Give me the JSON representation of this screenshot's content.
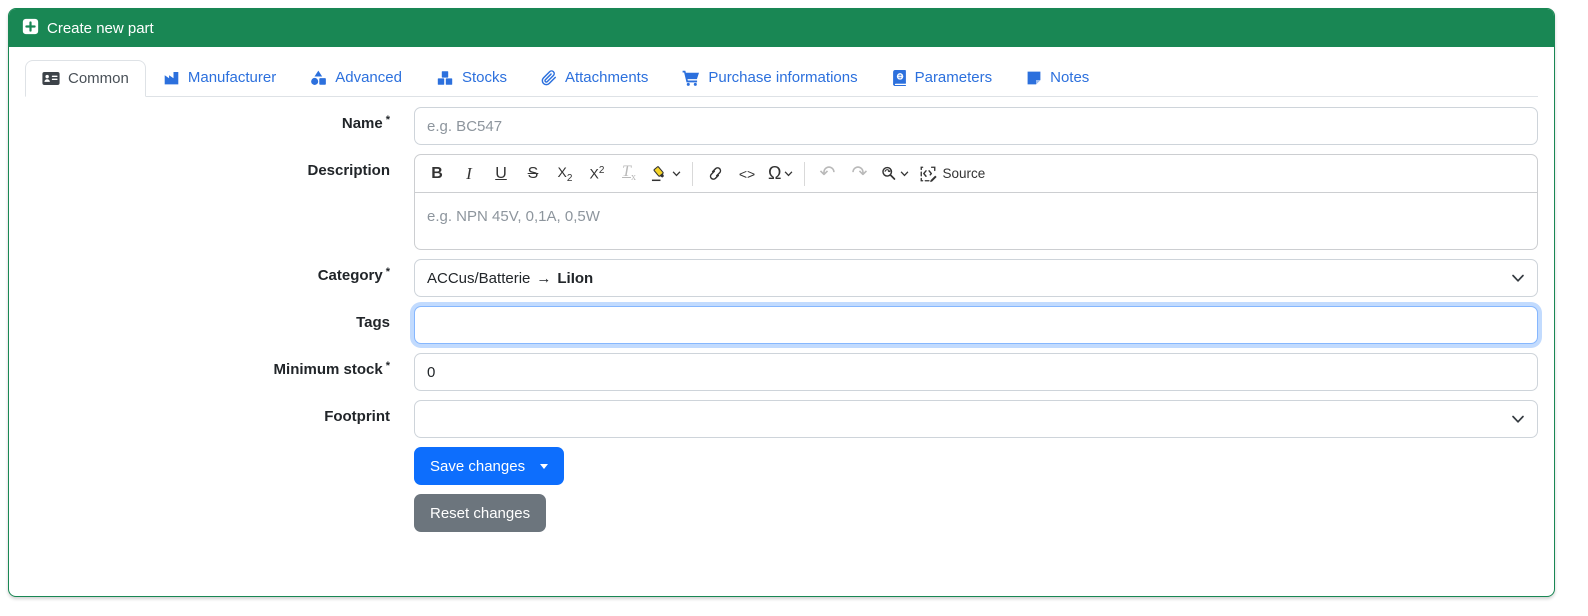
{
  "header": {
    "title": "Create new part",
    "icon": "plus-square-icon",
    "color": "#198754"
  },
  "tabs": [
    {
      "label": "Common",
      "icon": "id-card-icon",
      "active": true
    },
    {
      "label": "Manufacturer",
      "icon": "factory-icon",
      "active": false
    },
    {
      "label": "Advanced",
      "icon": "shapes-icon",
      "active": false
    },
    {
      "label": "Stocks",
      "icon": "cubes-icon",
      "active": false
    },
    {
      "label": "Attachments",
      "icon": "paperclip-icon",
      "active": false
    },
    {
      "label": "Purchase informations",
      "icon": "shopping-cart-icon",
      "active": false
    },
    {
      "label": "Parameters",
      "icon": "atlas-book-icon",
      "active": false
    },
    {
      "label": "Notes",
      "icon": "sticky-note-icon",
      "active": false
    }
  ],
  "form": {
    "name_label": "Name",
    "name_required": "*",
    "name_placeholder": "e.g. BC547",
    "name_value": "",
    "description_label": "Description",
    "category_label": "Category",
    "category_required": "*",
    "category_value_parent": "ACCus/Batterie",
    "category_value_arrow": "→",
    "category_value_child": "LiIon",
    "tags_label": "Tags",
    "tags_value": "",
    "minimum_stock_label": "Minimum stock",
    "minimum_stock_required": "*",
    "minimum_stock_value": "0",
    "footprint_label": "Footprint",
    "footprint_value": ""
  },
  "editor": {
    "placeholder": "e.g. NPN 45V, 0,1A, 0,5W",
    "toolbar": {
      "bold": "B",
      "italic": "I",
      "underline": "U",
      "strikethrough": "S",
      "subscript_base": "X",
      "subscript_small": "2",
      "superscript_base": "X",
      "superscript_small": "2",
      "remove_format_base": "T",
      "remove_format_small": "x",
      "code": "<>",
      "special_char": "Ω",
      "undo": "↶",
      "redo": "↷",
      "source_label": "Source"
    }
  },
  "buttons": {
    "save": "Save changes",
    "reset": "Reset changes"
  },
  "colors": {
    "header_green": "#198754",
    "tab_link_blue": "#2c70dd",
    "save_blue": "#0d6efd",
    "reset_gray": "#6c757d",
    "focus_ring_blue": "#86b7fe",
    "highlight_yellow": "#f5d428"
  }
}
